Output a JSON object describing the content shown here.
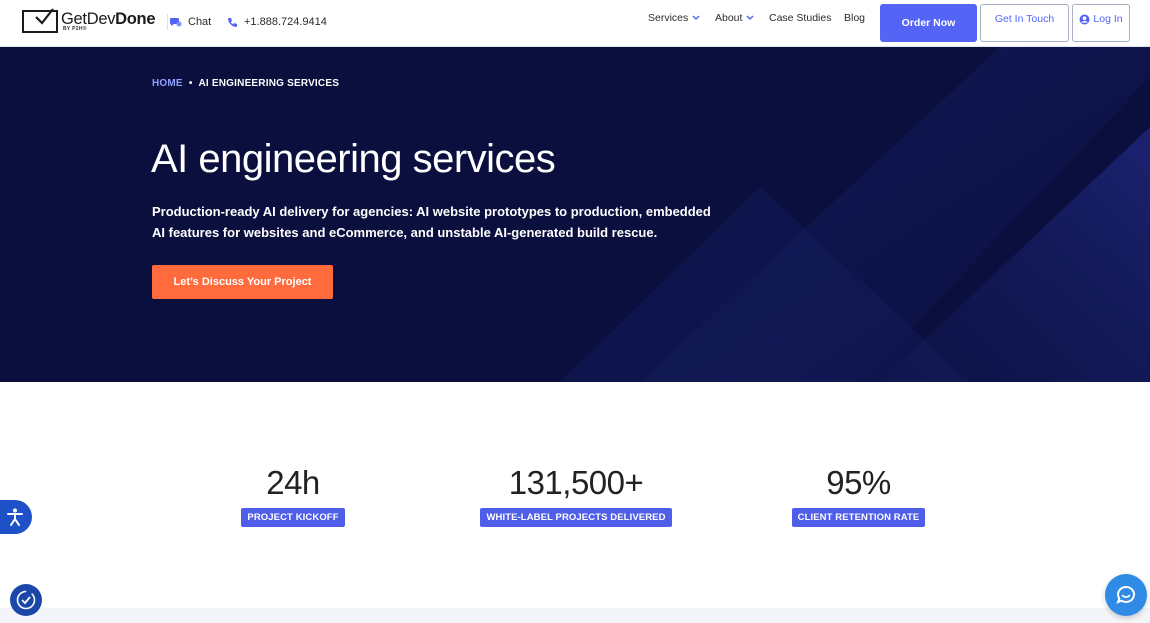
{
  "header": {
    "logo": {
      "part1": "Get",
      "part2": "Dev",
      "part3": "Done",
      "sub": "BY P2H®"
    },
    "chat_label": "Chat",
    "phone": "+1.888.724.9414",
    "nav": [
      {
        "label": "Services",
        "has_dropdown": true
      },
      {
        "label": "About",
        "has_dropdown": true
      },
      {
        "label": "Case Studies",
        "has_dropdown": false
      },
      {
        "label": "Blog",
        "has_dropdown": false
      }
    ],
    "order_now": "Order Now",
    "get_in_touch": "Get In Touch",
    "log_in": "Log In"
  },
  "hero": {
    "breadcrumb": {
      "home": "HOME",
      "separator": "•",
      "current": "AI ENGINEERING SERVICES"
    },
    "title": "AI engineering services",
    "description_line1": "Production-ready AI delivery for agencies: AI website prototypes to production, embedded",
    "description_line2": "AI features for websites and eCommerce, and unstable AI-generated build rescue.",
    "cta": "Let’s Discuss Your Project"
  },
  "stats": [
    {
      "value": "24h",
      "label": "PROJECT KICKOFF"
    },
    {
      "value": "131,500+",
      "label": "WHITE-LABEL PROJECTS DELIVERED"
    },
    {
      "value": "95%",
      "label": "CLIENT RETENTION RATE"
    }
  ],
  "colors": {
    "primary": "#5465f6",
    "hero_bg": "#0a0f3e",
    "cta_orange": "#ff6b3d",
    "stat_badge": "#4e5ee8"
  },
  "icons": {
    "accessibility": "accessibility-icon",
    "consent": "consent-icon",
    "chat_widget": "chat-widget-icon"
  }
}
